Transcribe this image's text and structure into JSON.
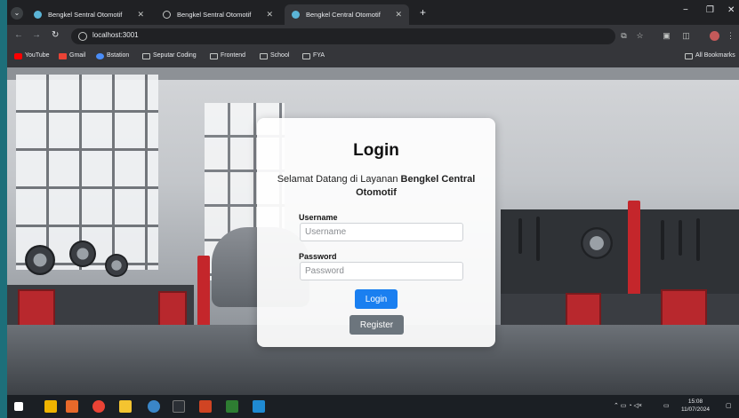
{
  "tabs": [
    {
      "title": "Bengkel Sentral Otomotif",
      "active": false
    },
    {
      "title": "Bengkel Sentral Otomotif",
      "active": false
    },
    {
      "title": "Bengkel Central Otomotif",
      "active": true
    }
  ],
  "address": {
    "url": "localhost:3001"
  },
  "bookmarks": [
    {
      "label": "YouTube",
      "icon": "youtube-icon"
    },
    {
      "label": "Gmail",
      "icon": "gmail-icon"
    },
    {
      "label": "Bstation",
      "icon": "bstation-icon"
    },
    {
      "label": "Seputar Coding",
      "icon": "folder-icon"
    },
    {
      "label": "Frontend",
      "icon": "folder-icon"
    },
    {
      "label": "School",
      "icon": "folder-icon"
    },
    {
      "label": "FYA",
      "icon": "folder-icon"
    }
  ],
  "all_bookmarks": "All Bookmarks",
  "login": {
    "title": "Login",
    "welcome_prefix": "Selamat Datang di Layanan ",
    "welcome_brand": "Bengkel Central Otomotif",
    "username_label": "Username",
    "username_placeholder": "Username",
    "password_label": "Password",
    "password_placeholder": "Password",
    "login_button": "Login",
    "register_button": "Register"
  },
  "taskbar": {
    "time": "15:08",
    "date": "11/07/2024"
  },
  "colors": {
    "primary_button": "#1a7ff0",
    "secondary_button": "#6c757d",
    "chrome_dark": "#202124",
    "desktop_teal": "#1d6f7a"
  }
}
